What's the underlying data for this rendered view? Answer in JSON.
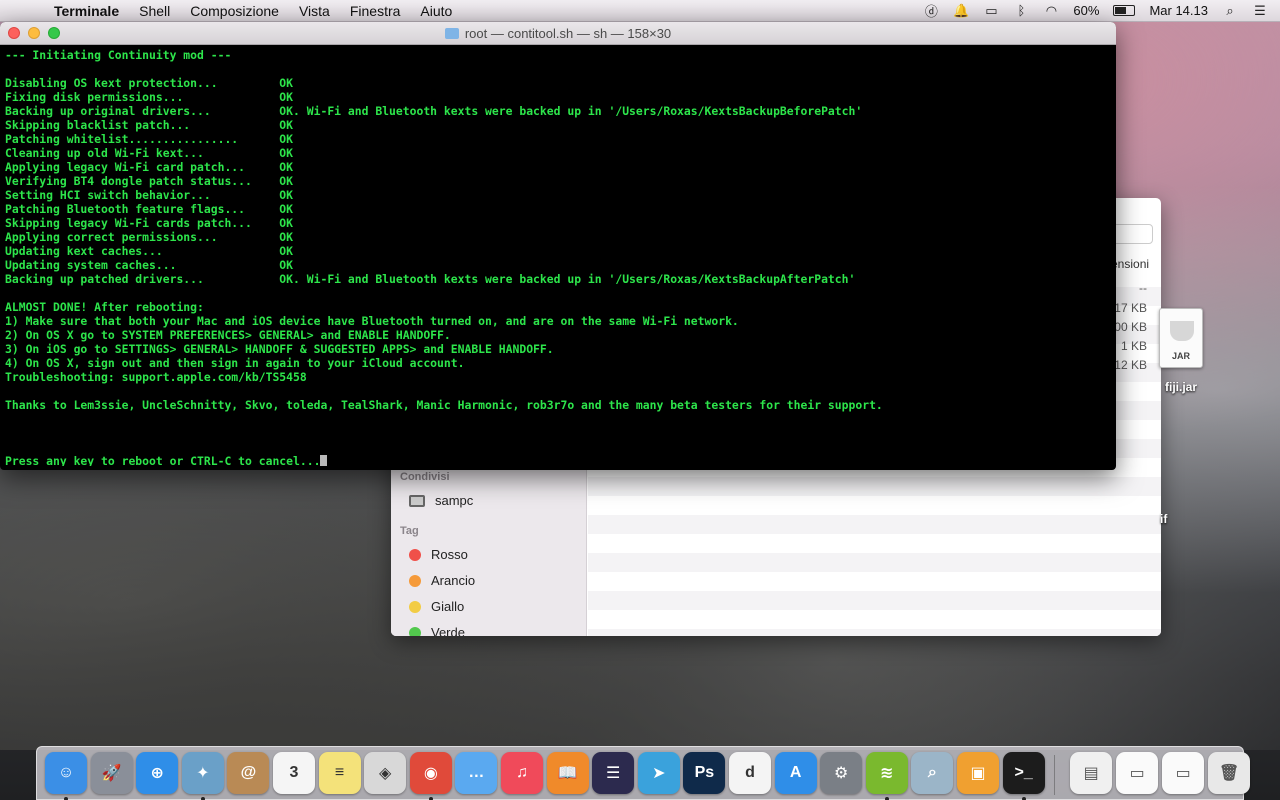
{
  "menubar": {
    "app_name": "Terminale",
    "items": [
      "Shell",
      "Composizione",
      "Vista",
      "Finestra",
      "Aiuto"
    ],
    "battery_percent": "60%",
    "battery_level": 0.6,
    "clock": "Mar 14.13",
    "status_icons": [
      "d-icon",
      "notification-icon",
      "airplay-icon",
      "bluetooth-icon",
      "wifi-icon",
      "battery-icon",
      "spotlight-icon",
      "notification-center-icon"
    ]
  },
  "terminal": {
    "title": "root — contitool.sh — sh — 158×30",
    "lines": [
      "--- Initiating Continuity mod ---",
      "",
      "Disabling OS kext protection...         OK",
      "Fixing disk permissions...              OK",
      "Backing up original drivers...          OK. Wi-Fi and Bluetooth kexts were backed up in '/Users/Roxas/KextsBackupBeforePatch'",
      "Skipping blacklist patch...             OK",
      "Patching whitelist................      OK",
      "Cleaning up old Wi-Fi kext...           OK",
      "Applying legacy Wi-Fi card patch...     OK",
      "Verifying BT4 dongle patch status...    OK",
      "Setting HCI switch behavior...          OK",
      "Patching Bluetooth feature flags...     OK",
      "Skipping legacy Wi-Fi cards patch...    OK",
      "Applying correct permissions...         OK",
      "Updating kext caches...                 OK",
      "Updating system caches...               OK",
      "Backing up patched drivers...           OK. Wi-Fi and Bluetooth kexts were backed up in '/Users/Roxas/KextsBackupAfterPatch'",
      "",
      "ALMOST DONE! After rebooting:",
      "1) Make sure that both your Mac and iOS device have Bluetooth turned on, and are on the same Wi-Fi network.",
      "2) On OS X go to SYSTEM PREFERENCES> GENERAL> and ENABLE HANDOFF.",
      "3) On iOS go to SETTINGS> GENERAL> HANDOFF & SUGGESTED APPS> and ENABLE HANDOFF.",
      "4) On OS X, sign out and then sign in again to your iCloud account.",
      "Troubleshooting: support.apple.com/kb/TS5458",
      "",
      "Thanks to Lem3ssie, UncleSchnitty, Skvo, toleda, TealShark, Manic Harmonic, rob3r7o and the many beta testers for their support.",
      "",
      "",
      "",
      "Press any key to reboot or CTRL-C to cancel..."
    ]
  },
  "finder": {
    "column_header": "ensioni",
    "sizes": [
      "--",
      "17 KB",
      "00 KB",
      "1 KB",
      "12 KB"
    ],
    "sidebar": {
      "shared_heading": "Condivisi",
      "shared_items": [
        "sampc"
      ],
      "tags_heading": "Tag",
      "tags": [
        {
          "label": "Rosso",
          "color": "#f0504a"
        },
        {
          "label": "Arancio",
          "color": "#f59a3a"
        },
        {
          "label": "Giallo",
          "color": "#f2cc45"
        },
        {
          "label": "Verde",
          "color": "#52c84d"
        }
      ]
    }
  },
  "desktop": {
    "icon_label": "fiji.jar",
    "icon_badge": "JAR",
    "partial_label": "if"
  },
  "dock": {
    "apps": [
      {
        "name": "finder-icon",
        "color": "#3b8fe6",
        "glyph": "☺",
        "running": true
      },
      {
        "name": "launchpad-icon",
        "color": "#8a8f99",
        "glyph": "🚀",
        "running": false
      },
      {
        "name": "safari-icon",
        "color": "#2f8ee8",
        "glyph": "⊕",
        "running": false
      },
      {
        "name": "preview-icon",
        "color": "#6aa0c8",
        "glyph": "✦",
        "running": true
      },
      {
        "name": "contacts-icon",
        "color": "#b98a55",
        "glyph": "@",
        "running": false
      },
      {
        "name": "calendar-icon",
        "color": "#f5f5f5",
        "glyph": "3",
        "running": false
      },
      {
        "name": "notes-icon",
        "color": "#f4e27a",
        "glyph": "≡",
        "running": false
      },
      {
        "name": "photos-icon",
        "color": "#d8d8d8",
        "glyph": "◈",
        "running": false
      },
      {
        "name": "chrome-icon",
        "color": "#e04a3a",
        "glyph": "◉",
        "running": true
      },
      {
        "name": "messages-icon",
        "color": "#5aa9f0",
        "glyph": "…",
        "running": false
      },
      {
        "name": "itunes-icon",
        "color": "#f04a5a",
        "glyph": "♫",
        "running": false
      },
      {
        "name": "ibooks-icon",
        "color": "#f08a2a",
        "glyph": "📖",
        "running": false
      },
      {
        "name": "eclipse-icon",
        "color": "#2c2a4e",
        "glyph": "☰",
        "running": false
      },
      {
        "name": "telegram-icon",
        "color": "#3aa2dc",
        "glyph": "➤",
        "running": false
      },
      {
        "name": "photoshop-icon",
        "color": "#0f2a4a",
        "glyph": "Ps",
        "running": false
      },
      {
        "name": "dashlane-icon",
        "color": "#f4f4f4",
        "glyph": "d",
        "running": false
      },
      {
        "name": "appstore-icon",
        "color": "#2f8ee8",
        "glyph": "A",
        "running": false
      },
      {
        "name": "system-preferences-icon",
        "color": "#7a7f86",
        "glyph": "⚙",
        "running": false
      },
      {
        "name": "spotify-icon",
        "color": "#7ab92e",
        "glyph": "≋",
        "running": true
      },
      {
        "name": "image-capture-icon",
        "color": "#9bb5c8",
        "glyph": "⌕",
        "running": false
      },
      {
        "name": "remote-desktop-icon",
        "color": "#f0a030",
        "glyph": "▣",
        "running": false
      },
      {
        "name": "terminal-icon",
        "color": "#1c1c1c",
        "glyph": ">_",
        "running": true
      }
    ],
    "docs": [
      {
        "name": "document-stack-icon",
        "color": "#f0f0f0",
        "glyph": "▤"
      },
      {
        "name": "window-thumbnail-icon",
        "color": "#fafafa",
        "glyph": "▭"
      },
      {
        "name": "chrome-window-thumbnail-icon",
        "color": "#fafafa",
        "glyph": "▭"
      },
      {
        "name": "trash-icon",
        "color": "#e8e8e8",
        "glyph": "🗑"
      }
    ]
  }
}
